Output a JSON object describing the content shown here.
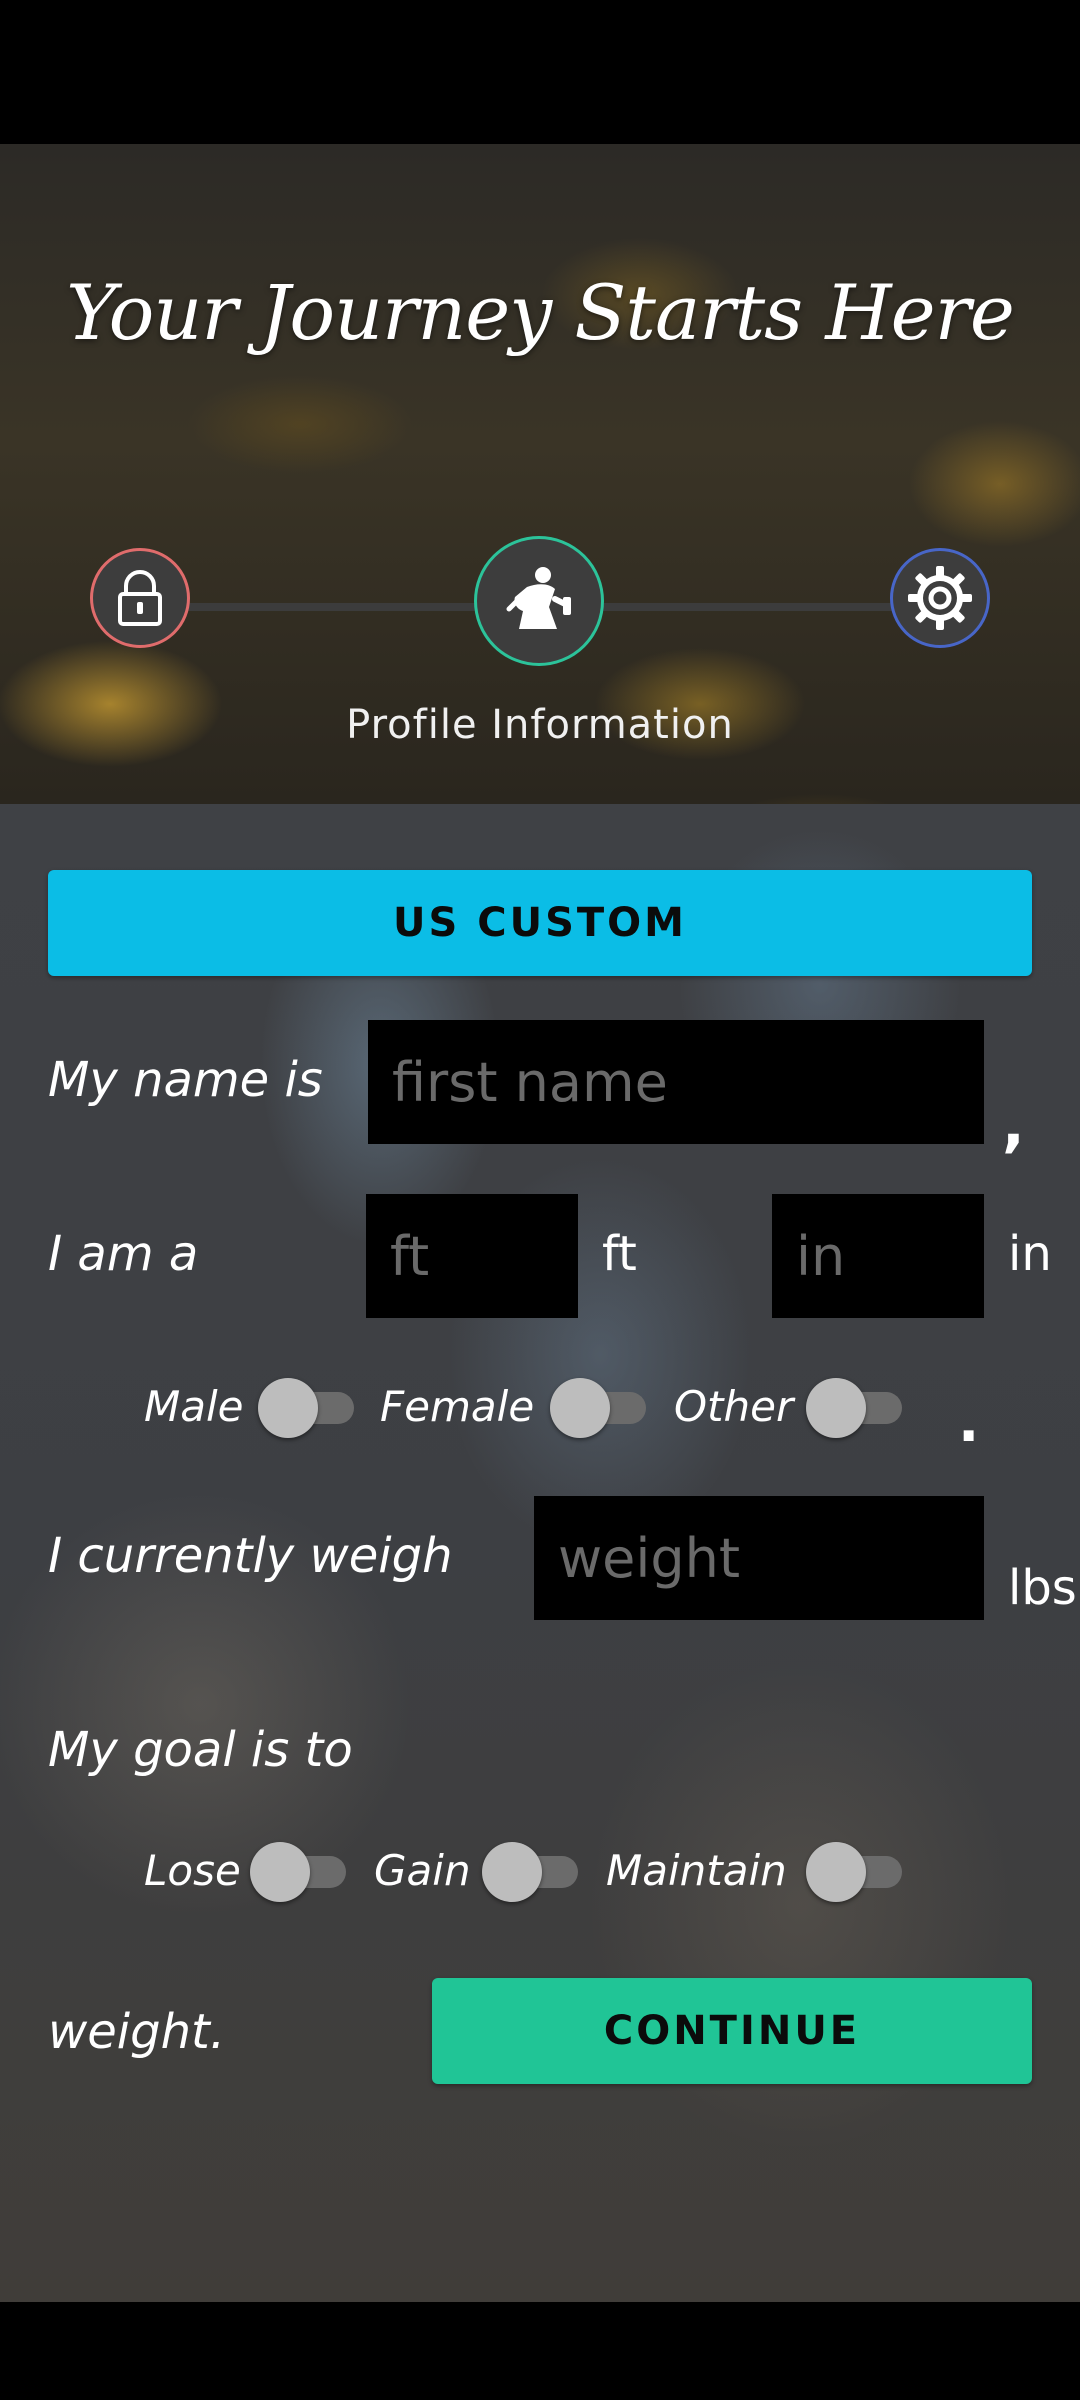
{
  "header": {
    "title": "Your Journey Starts Here"
  },
  "steps": {
    "items": [
      {
        "icon": "lock-icon",
        "color": "#e06c6c"
      },
      {
        "icon": "fitness-person-icon",
        "color": "#2cc39a"
      },
      {
        "icon": "gear-icon",
        "color": "#4866c8"
      }
    ],
    "current_label": "Profile Information"
  },
  "form": {
    "units_button": "US CUSTOM",
    "name": {
      "label": "My name is",
      "placeholder": "first name",
      "value": "",
      "suffix": ","
    },
    "height": {
      "label": "I am a",
      "ft_placeholder": "ft",
      "ft_unit": "ft",
      "in_placeholder": "in",
      "in_unit": "in"
    },
    "gender": {
      "options": [
        {
          "label": "Male",
          "checked": false
        },
        {
          "label": "Female",
          "checked": false
        },
        {
          "label": "Other",
          "checked": false
        }
      ],
      "suffix": "."
    },
    "weight": {
      "label": "I currently weigh",
      "placeholder": "weight",
      "unit": "lbs"
    },
    "goal": {
      "label": "My goal is to",
      "options": [
        {
          "label": "Lose",
          "checked": false
        },
        {
          "label": "Gain",
          "checked": false
        },
        {
          "label": "Maintain",
          "checked": false
        }
      ],
      "suffix_label": "weight."
    },
    "continue_button": "CONTINUE"
  },
  "colors": {
    "units_button": "#0bbde6",
    "continue_button": "#20c596",
    "input_background": "#000000"
  }
}
